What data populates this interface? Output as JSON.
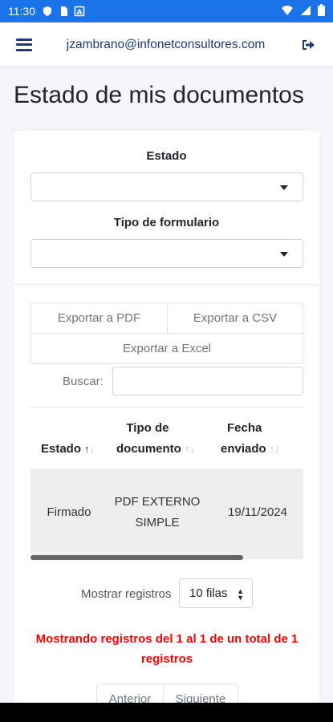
{
  "status_bar": {
    "time": "11:30"
  },
  "header": {
    "email": "jzambrano@infonetconsultores.com"
  },
  "page": {
    "title": "Estado de mis documentos"
  },
  "filters": {
    "estado_label": "Estado",
    "estado_value": "",
    "tipo_label": "Tipo de formulario",
    "tipo_value": ""
  },
  "export": {
    "pdf": "Exportar a PDF",
    "csv": "Exportar a CSV",
    "excel": "Exportar a Excel"
  },
  "search": {
    "label": "Buscar:",
    "value": ""
  },
  "table": {
    "columns": [
      {
        "line1": "Estado",
        "line2": ""
      },
      {
        "line1": "Tipo de",
        "line2": "documento"
      },
      {
        "line1": "Fecha",
        "line2": "enviado"
      }
    ],
    "rows": [
      {
        "estado": "Firmado",
        "tipo_line1": "PDF EXTERNO",
        "tipo_line2": "SIMPLE",
        "fecha": "19/11/2024"
      }
    ]
  },
  "length": {
    "label": "Mostrar registros",
    "value": "10 filas"
  },
  "info": {
    "line1": "Mostrando registros del 1 al 1 de un total de 1",
    "line2": "registros"
  },
  "pagination": {
    "prev": "Anterior",
    "next": "Siguiente"
  },
  "colors": {
    "accent": "#1a73e8",
    "brand_text": "#1f3a78",
    "info_text": "#ff0000",
    "row_bg": "#eeeeee"
  }
}
